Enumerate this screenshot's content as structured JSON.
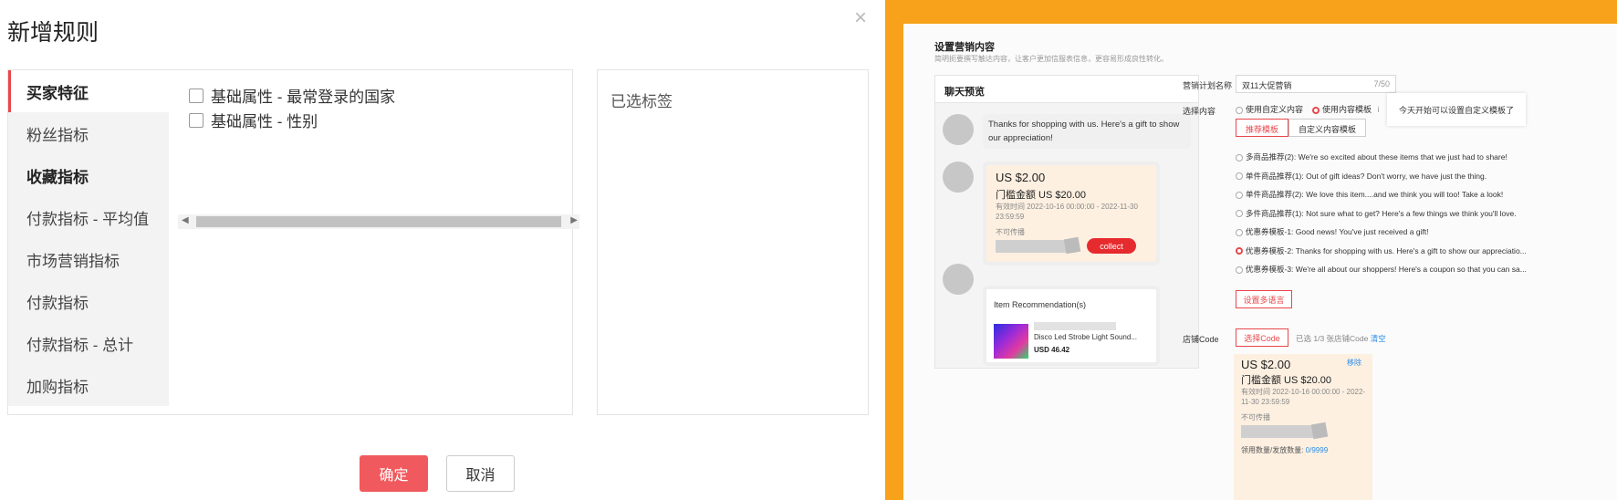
{
  "modal": {
    "title": "新增规则",
    "close": "×",
    "sidebar": [
      {
        "label": "买家特征"
      },
      {
        "label": "粉丝指标"
      },
      {
        "label": "收藏指标"
      },
      {
        "label": "付款指标 - 平均值"
      },
      {
        "label": "市场营销指标"
      },
      {
        "label": "付款指标"
      },
      {
        "label": "付款指标 - 总计"
      },
      {
        "label": "加购指标"
      }
    ],
    "options": [
      {
        "label": "基础属性 - 最常登录的国家"
      },
      {
        "label": "基础属性 - 性别"
      }
    ],
    "selected_title": "已选标签",
    "confirm": "确定",
    "cancel": "取消"
  },
  "marketing": {
    "title": "设置营销内容",
    "subtitle": "简明扼要撰写触达内容，让客户更加信服表信息，更容易形成良性转化。",
    "chat": {
      "header": "聊天预览",
      "message": "Thanks for shopping with us. Here's a gift to show our appreciation!",
      "coupon": {
        "amount": "US $2.00",
        "threshold": "门槛金额 US $20.00",
        "validity": "有效时间 2022-10-16 00:00:00 - 2022-11-30 23:59:59",
        "note": "不可传播",
        "collect": "collect"
      },
      "recommendation": {
        "title": "Item Recommendation(s)",
        "name": "Disco Led Strobe Light Sound...",
        "price": "USD 46.42"
      }
    },
    "form": {
      "plan_label": "营销计划名称",
      "plan_value": "双11大促营销",
      "plan_count": "7/50",
      "content_label": "选择内容",
      "opt_custom": "使用自定义内容",
      "opt_template": "使用内容模板",
      "info": "i",
      "tooltip": "今天开始可以设置自定义模板了",
      "tab_recommend": "推荐模板",
      "tab_custom": "自定义内容模板",
      "templates": [
        {
          "label": "多商品推荐(2): We're so excited about these items that we just had to share!",
          "selected": false
        },
        {
          "label": "单件商品推荐(1): Out of gift ideas? Don't worry, we have just the thing.",
          "selected": false
        },
        {
          "label": "单件商品推荐(2): We love this item....and we think you will too! Take a look!",
          "selected": false
        },
        {
          "label": "多件商品推荐(1): Not sure what to get? Here's a few things we think you'll love.",
          "selected": false
        },
        {
          "label": "优惠券模板-1: Good news! You've just received a gift!",
          "selected": false
        },
        {
          "label": "优惠券模板-2: Thanks for shopping with us. Here's a gift to show our appreciatio...",
          "selected": true
        },
        {
          "label": "优惠券模板-3: We're all about our shoppers! Here's a coupon so that you can sa...",
          "selected": false
        }
      ],
      "multilang": "设置多语言",
      "code_label": "店铺Code",
      "code_btn": "选择Code",
      "code_info": "已选 1/3 张店铺Code",
      "code_clear": "清空",
      "coupon": {
        "amount": "US $2.00",
        "remove": "移除",
        "threshold": "门槛金额 US $20.00",
        "validity": "有效时间 2022-10-16 00:00:00 - 2022-11-30 23:59:59",
        "note": "不可传播",
        "used_label": "领用数量/发放数量: ",
        "used_value": "0/9999"
      }
    }
  },
  "colors": {
    "accent": "#e8474b",
    "confirm": "#f05a5e",
    "frame": "#f7a21a",
    "coupon_bg": "#fdf0e1",
    "link": "#2b8de8"
  }
}
